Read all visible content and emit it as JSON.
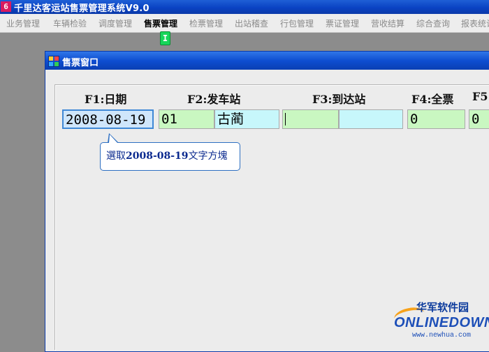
{
  "app": {
    "icon_label": "6",
    "title": "千里达客运站售票管理系统V9.0"
  },
  "menu": {
    "items": [
      {
        "label": "业务管理"
      },
      {
        "label": "车辆检验"
      },
      {
        "label": "调度管理"
      },
      {
        "label": "售票管理",
        "active": true
      },
      {
        "label": "检票管理"
      },
      {
        "label": "出站稽查"
      },
      {
        "label": "行包管理"
      },
      {
        "label": "票证管理"
      },
      {
        "label": "营收结算"
      },
      {
        "label": "综合查询"
      },
      {
        "label": "报表统计"
      }
    ],
    "cursor_glyph": "I"
  },
  "window": {
    "title": "售票窗口"
  },
  "form": {
    "labels": {
      "f1": "F1:日期",
      "f2": "F2:发车站",
      "f3": "F3:到达站",
      "f4": "F4:全票",
      "f5": "F5"
    },
    "fields": {
      "date": "2008-08-19",
      "depart_code": "01",
      "depart_name": "古蔺",
      "arrive_code": "",
      "arrive_name": "",
      "full_ticket": "0",
      "f5_value": "0"
    }
  },
  "tooltip": {
    "prefix": "選取",
    "date": "2008-08-19",
    "suffix": "文字方塊"
  },
  "watermark": {
    "brand_cn": "华军软件园",
    "brand_en": "ONLINEDOWN",
    "url": "www.newhua.com"
  },
  "colors": {
    "field_green": "#c9f7c1",
    "field_cyan": "#c7f7fb",
    "focus_border": "#3f88d6",
    "titlebar_blue": "#0a43c3"
  }
}
